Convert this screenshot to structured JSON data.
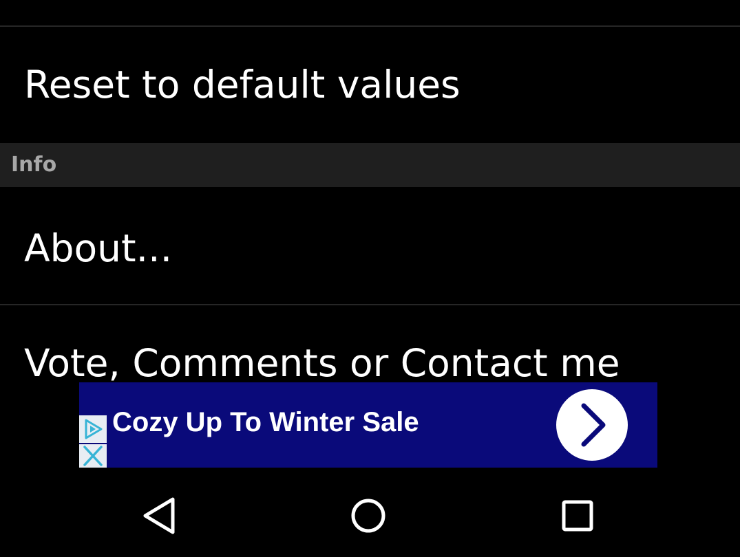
{
  "preferences": {
    "reset_label": "Reset to default values",
    "section_info": "Info",
    "about_label": "About...",
    "vote_label": "Vote, Comments or Contact me"
  },
  "ad": {
    "text": "Cozy Up To Winter Sale",
    "icons": {
      "choices": "adchoices-icon",
      "close": "close-icon",
      "arrow": "chevron-right-icon"
    },
    "colors": {
      "background": "#0a0a7a",
      "text": "#ffffff"
    }
  },
  "nav": {
    "icons": [
      "back-icon",
      "home-icon",
      "recents-icon"
    ]
  },
  "colors": {
    "background": "#000000",
    "section_header_bg": "#1f1f1f",
    "section_header_text": "#a8a8a8",
    "divider": "#262626"
  }
}
